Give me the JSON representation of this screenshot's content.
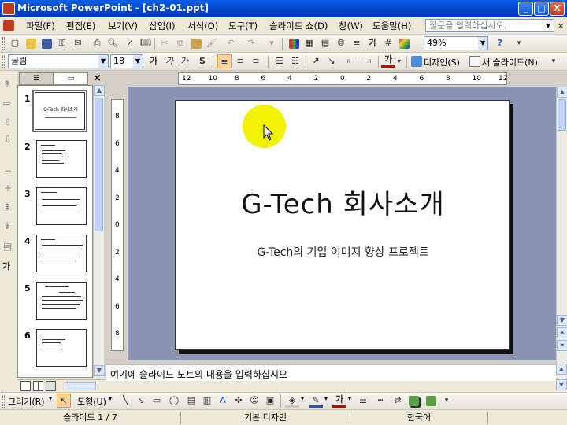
{
  "window": {
    "title": "Microsoft PowerPoint - [ch2-01.ppt]",
    "controls": [
      "_",
      "□",
      "X"
    ]
  },
  "menu": {
    "items": [
      "파일(F)",
      "편집(E)",
      "보기(V)",
      "삽입(I)",
      "서식(O)",
      "도구(T)",
      "슬라이드 쇼(D)",
      "창(W)",
      "도움말(H)"
    ],
    "ask_placeholder": "질문을 입력하십시오."
  },
  "standard_toolbar": {
    "zoom": "49%"
  },
  "format_toolbar": {
    "font": "굴림",
    "size": "18",
    "bold": "가",
    "italic": "가",
    "underline": "가",
    "shadow": "S",
    "font_color": "가",
    "design_label": "디자인(S)",
    "new_slide_label": "새 슬라이드(N)"
  },
  "panel": {
    "close": "×",
    "thumbnails": [
      {
        "num": "1",
        "title": "G-Tech 회사소개",
        "selected": true
      },
      {
        "num": "2",
        "selected": false
      },
      {
        "num": "3",
        "selected": false
      },
      {
        "num": "4",
        "selected": false
      },
      {
        "num": "5",
        "selected": false
      },
      {
        "num": "6",
        "selected": false
      }
    ]
  },
  "slide": {
    "title": "G-Tech 회사소개",
    "subtitle": "G-Tech의 기업 이미지 향상 프로젝트"
  },
  "ruler": {
    "h_ticks": [
      "12",
      "10",
      "8",
      "6",
      "4",
      "2",
      "0",
      "2",
      "4",
      "6",
      "8",
      "10",
      "12"
    ],
    "v_ticks": [
      "8",
      "6",
      "4",
      "2",
      "0",
      "2",
      "4",
      "6",
      "8"
    ]
  },
  "notes": {
    "placeholder": "여기에 슬라이드 노트의 내용을 입력하십시오"
  },
  "draw_toolbar": {
    "draw_label": "그리기(R)",
    "shapes_label": "도형(U)",
    "font_color": "가"
  },
  "statusbar": {
    "slide_info": "슬라이드 1 / 7",
    "design": "기본 디자인",
    "language": "한국어"
  },
  "colors": {
    "titlebar": "#0a5ee8",
    "canvas": "#8a93b1",
    "pointer": "#f2f205"
  }
}
